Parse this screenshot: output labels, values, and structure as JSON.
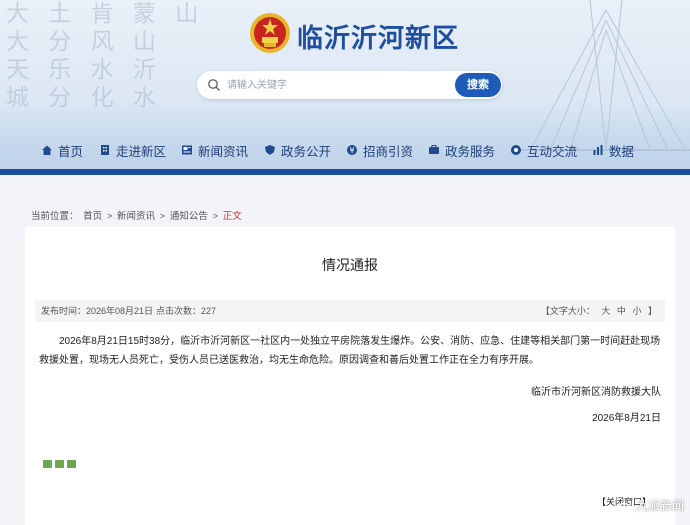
{
  "header": {
    "calligraphy": [
      "大 土 肯 蒙 山",
      "大 分 风 山",
      "天 乐 水 沂",
      "城 分 化 水"
    ],
    "site_title": "临沂沂河新区",
    "search_placeholder": "请输入关键字",
    "search_button": "搜索",
    "accent_color": "#1c4d9c"
  },
  "nav": {
    "items": [
      {
        "label": "首页",
        "icon": "home-icon"
      },
      {
        "label": "走进新区",
        "icon": "building-icon"
      },
      {
        "label": "新闻资讯",
        "icon": "news-icon"
      },
      {
        "label": "政务公开",
        "icon": "shield-icon"
      },
      {
        "label": "招商引资",
        "icon": "investment-icon"
      },
      {
        "label": "政务服务",
        "icon": "service-icon"
      },
      {
        "label": "互动交流",
        "icon": "chat-icon"
      },
      {
        "label": "数据",
        "icon": "chart-icon"
      }
    ]
  },
  "breadcrumb": {
    "prefix": "当前位置：",
    "items": [
      "首页",
      "新闻资讯",
      "通知公告"
    ],
    "separator": ">",
    "current": "正文"
  },
  "article": {
    "title": "情况通报",
    "publish_time": "发布时间：2026年08月21日",
    "views": "点击次数：227",
    "font_size_label": "【文字大小：",
    "font_sizes": [
      "大",
      "中",
      "小"
    ],
    "font_size_end": "】",
    "body": "2026年8月21日15时38分，临沂市沂河新区一社区内一处独立平房院落发生爆炸。公安、消防、应急、住建等相关部门第一时间赶赴现场救援处置，现场无人员死亡，受伤人员已送医救治，均无生命危险。原因调查和善后处置工作正在全力有序开展。",
    "signature": "临沂市沂河新区消防救援大队",
    "date": "2026年8月21日",
    "close_window": "【关闭窗口】"
  },
  "watermark": "九派新闻"
}
